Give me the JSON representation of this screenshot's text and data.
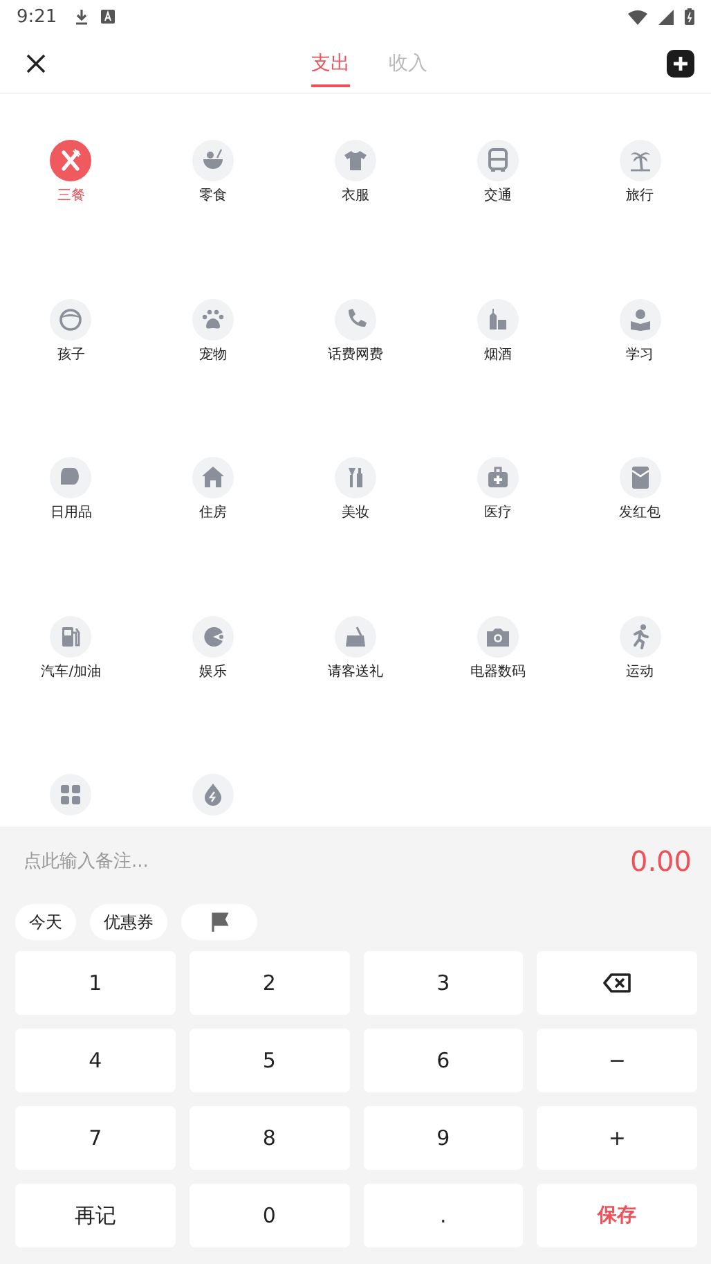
{
  "status_bar": {
    "time": "9:21"
  },
  "header": {
    "tabs": [
      {
        "label": "支出",
        "selected": true
      },
      {
        "label": "收入",
        "selected": false
      }
    ]
  },
  "categories": [
    {
      "label": "三餐",
      "selected": true
    },
    {
      "label": "零食",
      "selected": false
    },
    {
      "label": "衣服",
      "selected": false
    },
    {
      "label": "交通",
      "selected": false
    },
    {
      "label": "旅行",
      "selected": false
    },
    {
      "label": "孩子",
      "selected": false
    },
    {
      "label": "宠物",
      "selected": false
    },
    {
      "label": "话费网费",
      "selected": false
    },
    {
      "label": "烟酒",
      "selected": false
    },
    {
      "label": "学习",
      "selected": false
    },
    {
      "label": "日用品",
      "selected": false
    },
    {
      "label": "住房",
      "selected": false
    },
    {
      "label": "美妆",
      "selected": false
    },
    {
      "label": "医疗",
      "selected": false
    },
    {
      "label": "发红包",
      "selected": false
    },
    {
      "label": "汽车/加油",
      "selected": false
    },
    {
      "label": "娱乐",
      "selected": false
    },
    {
      "label": "请客送礼",
      "selected": false
    },
    {
      "label": "电器数码",
      "selected": false
    },
    {
      "label": "运动",
      "selected": false
    },
    {
      "selected": false
    },
    {
      "selected": false
    }
  ],
  "note": {
    "placeholder": "点此输入备注...",
    "amount": "0.00"
  },
  "chips": [
    {
      "kind": "text",
      "label": "今天"
    },
    {
      "kind": "text",
      "label": "优惠券"
    },
    {
      "kind": "flag"
    }
  ],
  "keypad": [
    {
      "kind": "key",
      "label": "1"
    },
    {
      "kind": "key",
      "label": "2"
    },
    {
      "kind": "key",
      "label": "3"
    },
    {
      "kind": "backspace"
    },
    {
      "kind": "key",
      "label": "4"
    },
    {
      "kind": "key",
      "label": "5"
    },
    {
      "kind": "key",
      "label": "6"
    },
    {
      "kind": "key",
      "label": "−"
    },
    {
      "kind": "key",
      "label": "7"
    },
    {
      "kind": "key",
      "label": "8"
    },
    {
      "kind": "key",
      "label": "9"
    },
    {
      "kind": "key",
      "label": "+"
    },
    {
      "kind": "key",
      "label": "再记"
    },
    {
      "kind": "key",
      "label": "0"
    },
    {
      "kind": "key",
      "label": "."
    },
    {
      "kind": "save",
      "label": "保存"
    }
  ]
}
